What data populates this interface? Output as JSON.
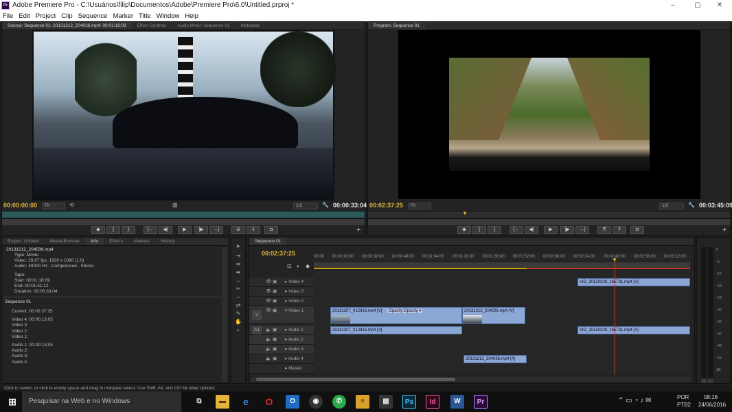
{
  "window": {
    "title": "Adobe Premiere Pro - C:\\Usuários\\filip\\Documentos\\Adobe\\Premiere Pro\\6.0\\Untitled.prproj *",
    "logo_text": "Pr",
    "controls": [
      "–",
      "▢",
      "✕"
    ]
  },
  "menu": [
    "File",
    "Edit",
    "Project",
    "Clip",
    "Sequence",
    "Marker",
    "Title",
    "Window",
    "Help"
  ],
  "source_monitor": {
    "tabs": [
      "Source: Sequence 01: 20131212_204036.mp4: 00:01:18:09",
      "Effect Controls",
      "Audio Mixer: Sequence 01",
      "Metadata"
    ],
    "timecode_current": "00:00:00:00",
    "timecode_duration": "00:00:33:04",
    "zoom": "Fit",
    "resolution": "1/2"
  },
  "program_monitor": {
    "tabs": [
      "Program: Sequence 01"
    ],
    "timecode_current": "00:02:37:25",
    "timecode_duration": "00:03:45:09",
    "zoom": "Fit",
    "resolution": "1/2"
  },
  "info_panel": {
    "tabs": [
      "Project: Untitled",
      "Media Browser",
      "Info",
      "Effects",
      "Markers",
      "History"
    ],
    "clip_name": "20131212_204036.mp4",
    "lines": [
      "Type: Movie",
      "Video: 29,97 fps, 1920 x 1080 (1,0)",
      "Audio: 48000 Hz - Compressed - Stereo",
      "Tape:",
      "Start: 00:01:18:09",
      "End: 00:01:51:12",
      "Duration: 00:00:33:04"
    ],
    "sequence_name": "Sequence 01",
    "seq_lines": [
      "Current: 00:02:37:25",
      "Video 4: 00:00:13;05",
      "Video 3:",
      "Video 2:",
      "Video 1:",
      "Audio 1: 00:00:13;05",
      "Audio 2:",
      "Audio 3:",
      "Audio 4:"
    ]
  },
  "timeline": {
    "tab": "Sequence 01",
    "timecode": "00:02:37:25",
    "ruler": [
      "00:00",
      "00:00:16:00",
      "00:00:32:00",
      "00:00:48:00",
      "00:01:04:00",
      "00:01:20:00",
      "00:01:36:00",
      "00:01:52:00",
      "00:02:08:00",
      "00:02:24:00",
      "00:02:40:00",
      "00:02:56:00",
      "00:03:12:00"
    ],
    "tracks": [
      "Video 4",
      "Video 3",
      "Video 2",
      "Video 1",
      "Audio 1",
      "Audio 2",
      "Audio 3",
      "Audio 4",
      "Master"
    ],
    "target_video": "V",
    "target_audio": "A1",
    "clips": {
      "v4": "VID_20150328_165731.mp4 [V]",
      "v1a": "20131207_012916.mp4 [V]",
      "v1a_fx": "Opacity:Opacity ▾",
      "v1b": "20131212_204036.mp4 [V]",
      "a1a": "20131207_012916.mp4 [A]",
      "a1b": "VID_20150328_165731.mp4 [A]",
      "a4": "20131212_204036.mp4 [A]"
    }
  },
  "meter_labels": [
    "0",
    "-6",
    "-12",
    "-18",
    "-24",
    "-30",
    "-36",
    "-42",
    "-48",
    "-54",
    "dB"
  ],
  "status_text": "Click to select, or click in empty space and drag to marquee select. Use Shift, Alt, and Ctrl for other options.",
  "taskbar": {
    "search_placeholder": "Pesquisar na Web e no Windows",
    "lang": "POR",
    "layout": "PTB2",
    "time": "08:16",
    "date": "24/06/2016"
  },
  "colors": {
    "accent_timecode": "#e3b83a",
    "clip": "#8ba7d4",
    "playhead": "#d43a2a"
  }
}
